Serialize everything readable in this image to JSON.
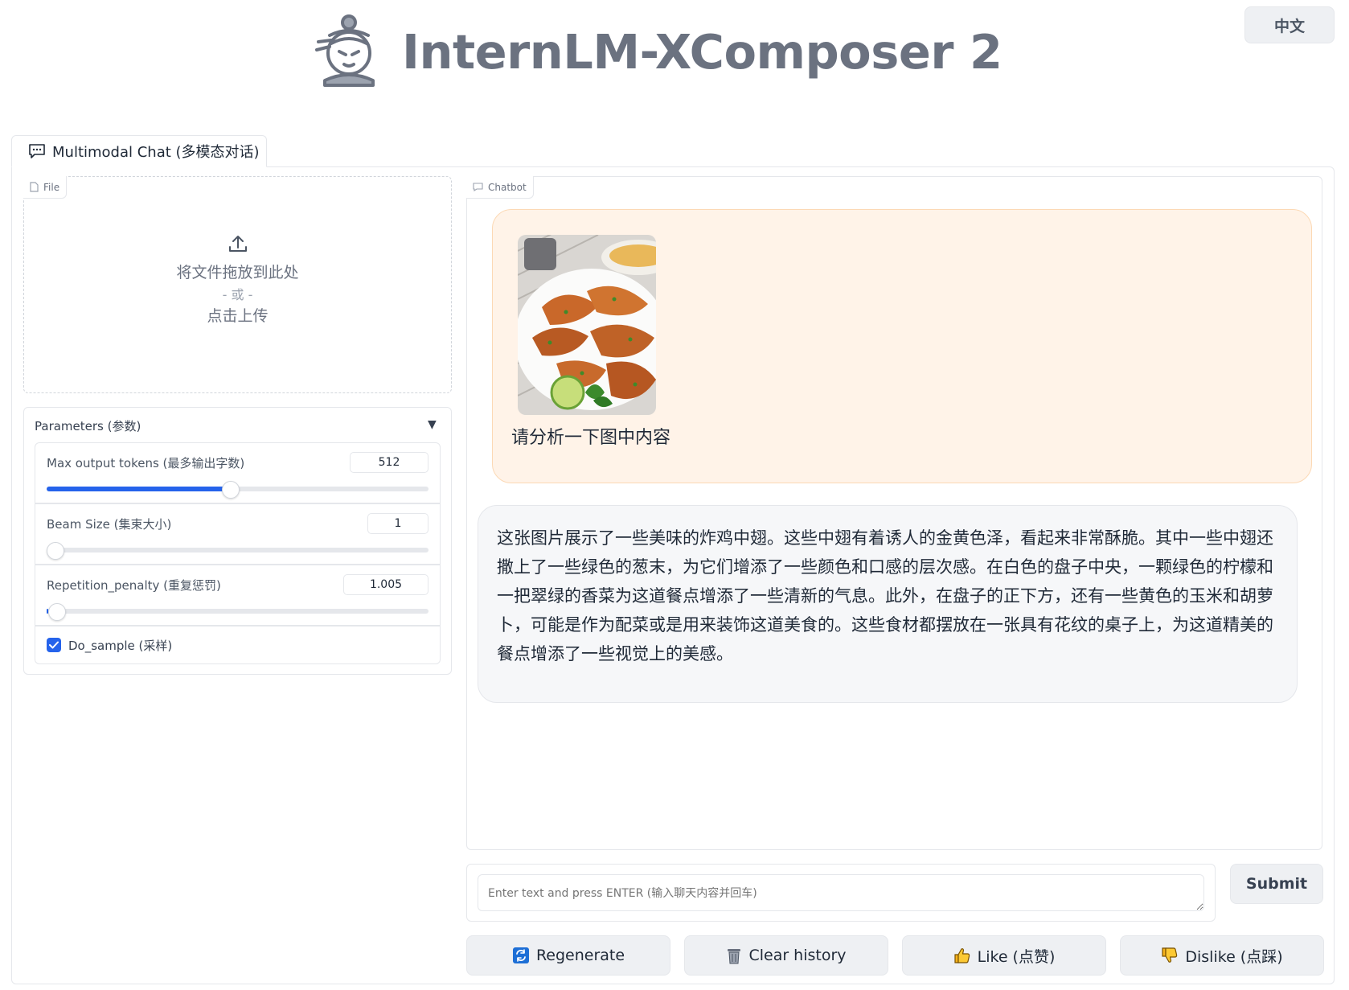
{
  "header": {
    "title": "InternLM-XComposer 2",
    "language_button": "中文"
  },
  "tabs": [
    {
      "label": "Multimodal Chat (多模态对话)",
      "icon": "chat-bubble-icon",
      "active": true
    }
  ],
  "file_panel": {
    "label": "File",
    "drop_text": "将文件拖放到此处",
    "or_text": "- 或 -",
    "click_text": "点击上传"
  },
  "parameters": {
    "title": "Parameters (参数)",
    "max_tokens": {
      "label": "Max output tokens (最多输出字数)",
      "value": "512",
      "fraction": 0.48
    },
    "beam_size": {
      "label": "Beam Size (集束大小)",
      "value": "1",
      "fraction": 0.0
    },
    "repetition_penalty": {
      "label": "Repetition_penalty (重复惩罚)",
      "value": "1.005",
      "fraction": 0.005
    },
    "do_sample": {
      "label": "Do_sample (采样)",
      "checked": true
    }
  },
  "chatbot": {
    "label": "Chatbot",
    "user_message": "请分析一下图中内容",
    "bot_message": "这张图片展示了一些美味的炸鸡中翅。这些中翅有着诱人的金黄色泽，看起来非常酥脆。其中一些中翅还撒上了一些绿色的葱末，为它们增添了一些颜色和口感的层次感。在白色的盘子中央，一颗绿色的柠檬和一把翠绿的香菜为这道餐点增添了一些清新的气息。此外，在盘子的正下方，还有一些黄色的玉米和胡萝卜，可能是作为配菜或是用来装饰这道美食的。这些食材都摆放在一张具有花纹的桌子上，为这道精美的餐点增添了一些视觉上的美感。"
  },
  "input": {
    "placeholder": "Enter text and press ENTER (输入聊天内容并回车)",
    "submit_label": "Submit"
  },
  "actions": {
    "regenerate": "Regenerate",
    "clear_history": "Clear history",
    "like": "Like (点赞)",
    "dislike": "Dislike (点踩)"
  },
  "colors": {
    "accent": "#2563eb",
    "user_bubble": "#fff3e8",
    "bot_bubble": "#f6f7f9",
    "title_gray": "#6b7280"
  }
}
